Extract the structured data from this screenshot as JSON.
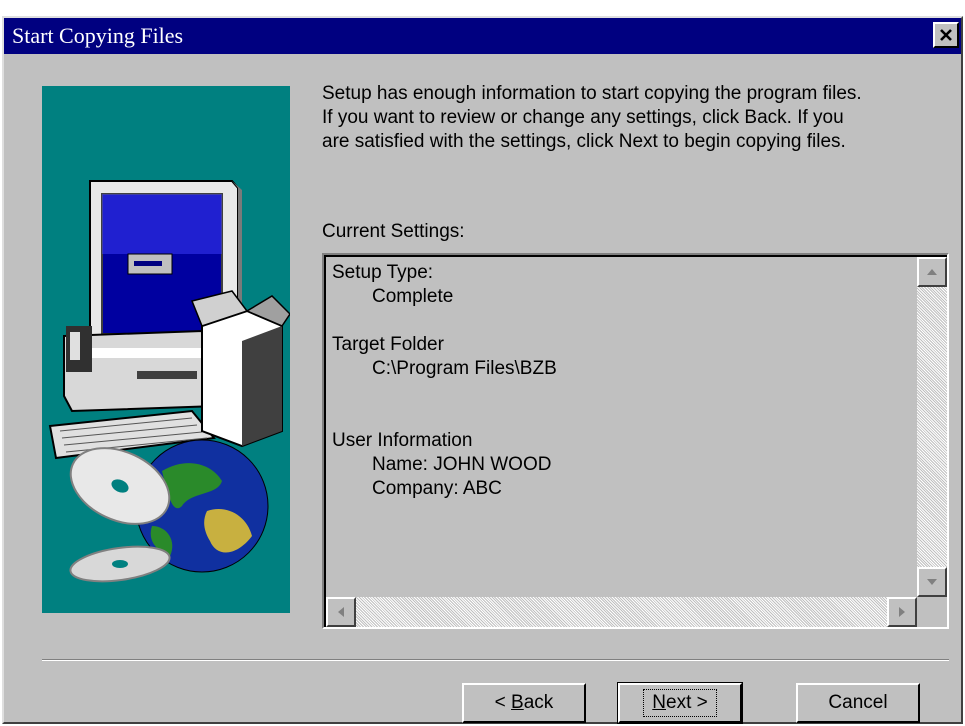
{
  "window": {
    "title": "Start Copying Files",
    "close_icon": "close-icon"
  },
  "illustration": {
    "icon": "setup-computer-illustration",
    "background": "#008080"
  },
  "description": {
    "line1": "Setup has enough information to start copying the program files.",
    "line2": "If you want to review or change any settings, click Back.  If you",
    "line3": "are satisfied with the settings, click Next to begin copying files."
  },
  "settings": {
    "label": "Current Settings:",
    "setup_type_label": "Setup Type:",
    "setup_type_value": "Complete",
    "target_folder_label": "Target Folder",
    "target_folder_value": "C:\\Program Files\\BZB",
    "user_info_label": "User Information",
    "name_line": "Name:  JOHN WOOD",
    "company_line": "Company:  ABC"
  },
  "buttons": {
    "back": "Back",
    "back_prefix": "< ",
    "back_mnemonic": "B",
    "back_rest": "ack",
    "next_mnemonic": "N",
    "next_rest": "ext >",
    "cancel": "Cancel"
  },
  "colors": {
    "titlebar": "#000080",
    "face": "#c0c0c0",
    "art_bg": "#008080"
  }
}
